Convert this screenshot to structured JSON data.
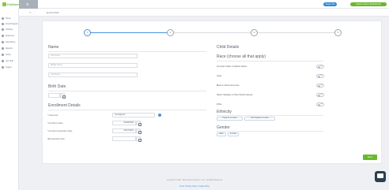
{
  "app": {
    "logo_text": "KidKare"
  },
  "header": {
    "blue_pill": "Single Site",
    "green_pill": "Sponsor Name (Dashboard)"
  },
  "sidebar": {
    "items": [
      {
        "label": "Home",
        "icon": "home-icon"
      },
      {
        "label": "Food Program",
        "icon": "food-icon"
      },
      {
        "label": "Children",
        "icon": "children-icon"
      },
      {
        "label": "Expenses",
        "icon": "expenses-icon"
      },
      {
        "label": "Attendance",
        "icon": "calendar-icon"
      },
      {
        "label": "Reports",
        "icon": "reports-icon"
      },
      {
        "label": "Setup",
        "icon": "gear-icon"
      },
      {
        "label": "Get Help",
        "icon": "help-icon"
      },
      {
        "label": "Logout",
        "icon": "logout-icon"
      }
    ]
  },
  "breadcrumb": {
    "current": "Enroll Child"
  },
  "stepper": {
    "steps": [
      "1",
      "2",
      "3",
      "4"
    ]
  },
  "left": {
    "name_title": "Name",
    "first_name_placeholder": "First Name",
    "middle_name_placeholder": "Middle Name",
    "last_name_placeholder": "Last Name",
    "birth_date_title": "Birth Date",
    "enrollment_title": "Enrollment Details",
    "classroom_label": "* Classroom",
    "classroom_value": "Unassigned",
    "enrollment_date_label": "* Enrollment Date",
    "enrollment_date_value": "04/28/2020",
    "expiration_label": "* Enrollment Expiration Date",
    "expiration_value": "04/27/2021",
    "iep_label": "IEP Expiration Date"
  },
  "right": {
    "child_details_title": "Child Details",
    "race_title": "Race (choose all that apply)",
    "race_options": [
      "American Indian or Alaskan Native",
      "Asian",
      "Black or African American",
      "Native Hawaiian or Other Pacific Islander",
      "White"
    ],
    "toggle_label": "No",
    "ethnicity_title": "Ethnicity",
    "ethnicity_options": [
      "Hispanic or Latino",
      "Not Hispanic or Latino"
    ],
    "gender_title": "Gender",
    "gender_options": [
      "Male",
      "Female"
    ]
  },
  "actions": {
    "next_label": "Next"
  },
  "footer": {
    "copyright": "Copyright © 2020 - Minute Menu Systems, LLC - All Rights Reserved",
    "links": "Terms | Privacy Policy | Cookie Policy"
  },
  "colors": {
    "accent_green": "#69b92d",
    "accent_blue": "#2f89d9",
    "link_blue": "#4a90e2"
  }
}
